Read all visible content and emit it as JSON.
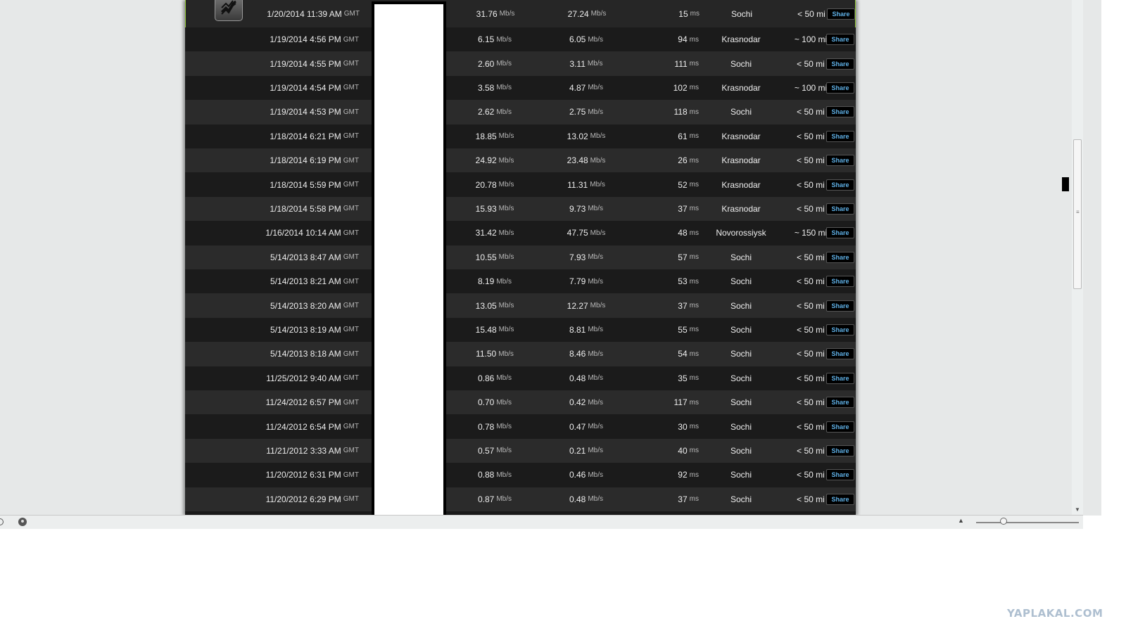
{
  "results": [
    {
      "date": "1/20/2014 11:39 AM",
      "tz": "GMT",
      "download": "31.76",
      "upload": "27.24",
      "ping": "15",
      "server": "Sochi",
      "distance": "< 50 mi",
      "share": "Share",
      "highlighted": true
    },
    {
      "date": "1/19/2014 4:56 PM",
      "tz": "GMT",
      "download": "6.15",
      "upload": "6.05",
      "ping": "94",
      "server": "Krasnodar",
      "distance": "~ 100 mi",
      "share": "Share"
    },
    {
      "date": "1/19/2014 4:55 PM",
      "tz": "GMT",
      "download": "2.60",
      "upload": "3.11",
      "ping": "111",
      "server": "Sochi",
      "distance": "< 50 mi",
      "share": "Share"
    },
    {
      "date": "1/19/2014 4:54 PM",
      "tz": "GMT",
      "download": "3.58",
      "upload": "4.87",
      "ping": "102",
      "server": "Krasnodar",
      "distance": "~ 100 mi",
      "share": "Share"
    },
    {
      "date": "1/19/2014 4:53 PM",
      "tz": "GMT",
      "download": "2.62",
      "upload": "2.75",
      "ping": "118",
      "server": "Sochi",
      "distance": "< 50 mi",
      "share": "Share"
    },
    {
      "date": "1/18/2014 6:21 PM",
      "tz": "GMT",
      "download": "18.85",
      "upload": "13.02",
      "ping": "61",
      "server": "Krasnodar",
      "distance": "< 50 mi",
      "share": "Share"
    },
    {
      "date": "1/18/2014 6:19 PM",
      "tz": "GMT",
      "download": "24.92",
      "upload": "23.48",
      "ping": "26",
      "server": "Krasnodar",
      "distance": "< 50 mi",
      "share": "Share"
    },
    {
      "date": "1/18/2014 5:59 PM",
      "tz": "GMT",
      "download": "20.78",
      "upload": "11.31",
      "ping": "52",
      "server": "Krasnodar",
      "distance": "< 50 mi",
      "share": "Share"
    },
    {
      "date": "1/18/2014 5:58 PM",
      "tz": "GMT",
      "download": "15.93",
      "upload": "9.73",
      "ping": "37",
      "server": "Krasnodar",
      "distance": "< 50 mi",
      "share": "Share"
    },
    {
      "date": "1/16/2014 10:14 AM",
      "tz": "GMT",
      "download": "31.42",
      "upload": "47.75",
      "ping": "48",
      "server": "Novorossiysk",
      "distance": "~ 150 mi",
      "share": "Share"
    },
    {
      "date": "5/14/2013 8:47 AM",
      "tz": "GMT",
      "download": "10.55",
      "upload": "7.93",
      "ping": "57",
      "server": "Sochi",
      "distance": "< 50 mi",
      "share": "Share"
    },
    {
      "date": "5/14/2013 8:21 AM",
      "tz": "GMT",
      "download": "8.19",
      "upload": "7.79",
      "ping": "53",
      "server": "Sochi",
      "distance": "< 50 mi",
      "share": "Share"
    },
    {
      "date": "5/14/2013 8:20 AM",
      "tz": "GMT",
      "download": "13.05",
      "upload": "12.27",
      "ping": "37",
      "server": "Sochi",
      "distance": "< 50 mi",
      "share": "Share"
    },
    {
      "date": "5/14/2013 8:19 AM",
      "tz": "GMT",
      "download": "15.48",
      "upload": "8.81",
      "ping": "55",
      "server": "Sochi",
      "distance": "< 50 mi",
      "share": "Share"
    },
    {
      "date": "5/14/2013 8:18 AM",
      "tz": "GMT",
      "download": "11.50",
      "upload": "8.46",
      "ping": "54",
      "server": "Sochi",
      "distance": "< 50 mi",
      "share": "Share"
    },
    {
      "date": "11/25/2012 9:40 AM",
      "tz": "GMT",
      "download": "0.86",
      "upload": "0.48",
      "ping": "35",
      "server": "Sochi",
      "distance": "< 50 mi",
      "share": "Share"
    },
    {
      "date": "11/24/2012 6:57 PM",
      "tz": "GMT",
      "download": "0.70",
      "upload": "0.42",
      "ping": "117",
      "server": "Sochi",
      "distance": "< 50 mi",
      "share": "Share"
    },
    {
      "date": "11/24/2012 6:54 PM",
      "tz": "GMT",
      "download": "0.78",
      "upload": "0.47",
      "ping": "30",
      "server": "Sochi",
      "distance": "< 50 mi",
      "share": "Share"
    },
    {
      "date": "11/21/2012 3:33 AM",
      "tz": "GMT",
      "download": "0.57",
      "upload": "0.21",
      "ping": "40",
      "server": "Sochi",
      "distance": "< 50 mi",
      "share": "Share"
    },
    {
      "date": "11/20/2012 6:31 PM",
      "tz": "GMT",
      "download": "0.88",
      "upload": "0.46",
      "ping": "92",
      "server": "Sochi",
      "distance": "< 50 mi",
      "share": "Share"
    },
    {
      "date": "11/20/2012 6:29 PM",
      "tz": "GMT",
      "download": "0.87",
      "upload": "0.48",
      "ping": "37",
      "server": "Sochi",
      "distance": "< 50 mi",
      "share": "Share"
    }
  ],
  "units": {
    "speed": "Mb/s",
    "ping": "ms"
  },
  "icons": {
    "app": "speedtest-logo-icon",
    "status_left": "circle-icon",
    "status_speed": "speedometer-icon",
    "zoom_arrow": "triangle-up-icon"
  },
  "colors": {
    "highlight_border": "#8fc530",
    "share_text": "#5fb0e6",
    "panel_bg": "#1a1a1a"
  },
  "watermark": "YAPLAKAL.COM"
}
